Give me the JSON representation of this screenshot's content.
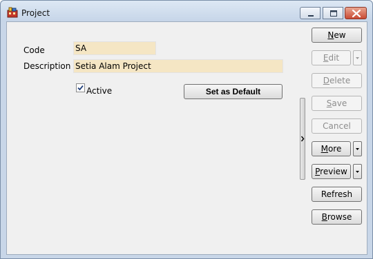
{
  "window": {
    "title": "Project"
  },
  "form": {
    "code_label": "Code",
    "code_value": "SA",
    "description_label": "Description",
    "description_value": "Setia Alam Project",
    "active_label": "Active",
    "active_checked": true,
    "set_default_label": "Set as Default"
  },
  "actions": {
    "new": "New",
    "edit": "Edit",
    "delete": "Delete",
    "save": "Save",
    "cancel": "Cancel",
    "more": "More",
    "preview": "Preview",
    "refresh": "Refresh",
    "browse": "Browse"
  },
  "icons": {
    "app": "project-app-icon",
    "minimize": "minimize-icon",
    "maximize": "maximize-icon",
    "close": "close-icon",
    "dropdown": "chevron-down-icon",
    "splitter": "chevron-right-icon",
    "check": "checkmark-icon"
  },
  "colors": {
    "input_background": "#f5e6c4",
    "client_background": "#f0f0f0",
    "disabled_text": "#8d8d8d",
    "close_button": "#c94a34"
  }
}
